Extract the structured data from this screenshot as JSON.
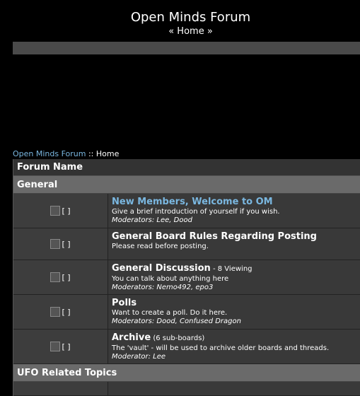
{
  "header": {
    "title": "Open Minds Forum",
    "home_link": "« Home »"
  },
  "breadcrumb": {
    "link": "Open Minds Forum",
    "separator": " :: ",
    "current": "Home"
  },
  "table": {
    "header": "Forum Name"
  },
  "categories": [
    {
      "name": "General"
    },
    {
      "name": "UFO Related Topics"
    }
  ],
  "icon_alt": "[ ]",
  "forums": [
    {
      "name": "New Members, Welcome to OM",
      "extra": "",
      "description": "Give a brief introduction of yourself if you wish.",
      "moderators": "Moderators: Lee, Dood"
    },
    {
      "name": "General Board Rules Regarding Posting",
      "extra": "",
      "description": "Please read before posting.",
      "moderators": ""
    },
    {
      "name": "General Discussion",
      "extra": " - 8 Viewing",
      "description": "You can talk about anything here",
      "moderators": "Moderators: Nemo492, epo3"
    },
    {
      "name": "Polls",
      "extra": "",
      "description": "Want to create a poll. Do it here.",
      "moderators": "Moderators: Dood, Confused Dragon"
    },
    {
      "name": "Archive",
      "extra": " (6 sub-boards)",
      "description": "The 'vault' - will be used to archive older boards and threads.",
      "moderators": "Moderator: Lee"
    }
  ]
}
